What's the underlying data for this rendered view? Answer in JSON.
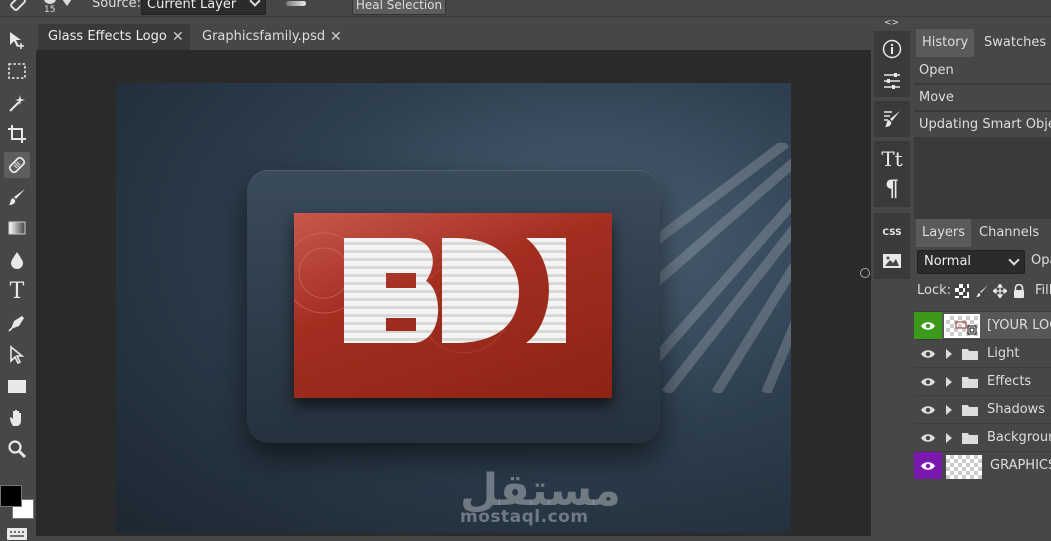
{
  "options_bar": {
    "brush_size": "15",
    "source_label": "Source:",
    "source_value": "Current Layer",
    "heal_button": "Heal Selection"
  },
  "toolbar": {
    "tools": [
      "select-move-icon",
      "marquee-icon",
      "magic-wand-icon",
      "crop-icon",
      "healing-brush-icon",
      "brush-icon",
      "gradient-icon",
      "blur-drop-icon",
      "type-icon",
      "pen-icon",
      "direct-select-icon",
      "rectangle-icon",
      "hand-icon",
      "zoom-icon"
    ],
    "type_glyph": "T",
    "foreground": "#000000",
    "background": "#ffffff"
  },
  "document_tabs": [
    {
      "label": "Glass Effects Logo",
      "close": "✕",
      "active": true
    },
    {
      "label": "Graphicsfamily.psd",
      "close": "✕",
      "active": false
    }
  ],
  "canvas": {
    "logo_text": "BD",
    "watermark_arabic": "مستقل",
    "watermark_url": "mostaql.com",
    "accent_red": "#a22e20"
  },
  "side_strip": {
    "collapse": "<>",
    "icons": [
      "info-icon",
      "adjustments-icon",
      "brush-preset-icon",
      "character-icon",
      "paragraph-icon",
      "css-icon",
      "image-icon"
    ],
    "char_glyph": "Tt",
    "para_glyph": "¶",
    "css_label": "CSS"
  },
  "history_panel": {
    "tabs": [
      "History",
      "Swatches"
    ],
    "items": [
      "Open",
      "Move",
      "Updating Smart Object"
    ]
  },
  "layers_panel": {
    "tabs": [
      "Layers",
      "Channels"
    ],
    "blend_mode": "Normal",
    "opacity_label": "Opacity",
    "lock_label": "Lock:",
    "fill_label": "Fill",
    "layers": [
      {
        "name": "[YOUR LOGO]",
        "kind": "smart",
        "eye_color": "#3c9a1a"
      },
      {
        "name": "Light",
        "kind": "folder"
      },
      {
        "name": "Effects",
        "kind": "folder"
      },
      {
        "name": "Shadows",
        "kind": "folder"
      },
      {
        "name": "Background",
        "kind": "folder"
      },
      {
        "name": "GRAPHICSFAMILY",
        "kind": "layer",
        "eye_color": "#7a18b0"
      }
    ]
  }
}
